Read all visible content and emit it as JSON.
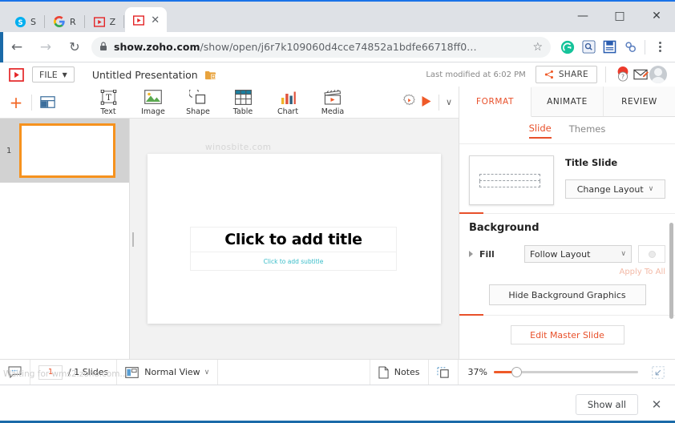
{
  "browser": {
    "tabs": [
      {
        "label": "S",
        "icon": "skype-icon",
        "active": false
      },
      {
        "label": "R",
        "icon": "google-icon",
        "active": false
      },
      {
        "label": "Z",
        "icon": "zoho-show-icon",
        "active": false
      },
      {
        "label": "",
        "icon": "zoho-show-icon",
        "active": true
      }
    ],
    "window_controls": {
      "minimize": "—",
      "maximize": "□",
      "close": "✕"
    },
    "nav": {
      "back": "←",
      "forward": "→",
      "reload": "↻"
    },
    "omnibox": {
      "lock": "lock-icon",
      "domain": "show.zoho.com",
      "path": "/show/open/j6r7k109060d4cce74852a1bdfe66718ff0…",
      "star": "☆"
    },
    "extensions": [
      "grammarly-icon",
      "magnifier-icon",
      "save-floppy-icon",
      "link-chain-icon"
    ],
    "menu": "kebab-menu-icon"
  },
  "app_header": {
    "logo": "zoho-show-logo",
    "file_menu": "FILE",
    "presentation_title": "Untitled Presentation",
    "folder_icon": "folder-add-icon",
    "last_modified": "Last modified at 6:02 PM",
    "share_label": "SHARE",
    "help_icon": "help-pin-icon",
    "feedback_icon": "feedback-edit-icon",
    "avatar": "user-avatar"
  },
  "insert_toolbar": {
    "add": "+",
    "layout_icon": "slide-layout-icon",
    "tools": [
      {
        "label": "Text",
        "icon": "text-box-icon"
      },
      {
        "label": "Image",
        "icon": "image-icon"
      },
      {
        "label": "Shape",
        "icon": "shape-icon"
      },
      {
        "label": "Table",
        "icon": "table-icon"
      },
      {
        "label": "Chart",
        "icon": "chart-icon"
      },
      {
        "label": "Media",
        "icon": "media-clapper-icon"
      }
    ],
    "settings_icon": "settings-gear-icon",
    "present_icon": "play-present-icon",
    "present_dropdown": "∨"
  },
  "right_panel": {
    "tabs": [
      {
        "label": "FORMAT",
        "active": true
      },
      {
        "label": "ANIMATE",
        "active": false
      },
      {
        "label": "REVIEW",
        "active": false
      }
    ],
    "subtabs": [
      {
        "label": "Slide",
        "active": true
      },
      {
        "label": "Themes",
        "active": false
      }
    ],
    "layout_name": "Title Slide",
    "change_layout": "Change Layout",
    "change_layout_caret": "∨",
    "background_title": "Background",
    "fill_label": "Fill",
    "fill_value": "Follow Layout",
    "fill_caret": "∨",
    "apply_to_all": "Apply To All",
    "hide_background": "Hide Background Graphics",
    "edit_master": "Edit Master Slide"
  },
  "workspace": {
    "slides": [
      {
        "number": "1"
      }
    ],
    "watermark": "winosbite.com",
    "title_placeholder": "Click to add title",
    "subtitle_placeholder": "Click to add subtitle"
  },
  "status_bar": {
    "comment_icon": "comment-icon",
    "current_slide": "1",
    "slide_count": "/ 1 Slides",
    "view_icon": "normal-view-icon",
    "view_label": "Normal View",
    "view_caret": "∨",
    "notes_icon": "notes-page-icon",
    "notes_label": "Notes",
    "grid_icon": "fit-slide-icon",
    "zoom_level": "37%",
    "fit_icon": "fit-screen-icon",
    "waiting_text": "Waiting for wms2.zoho.com…"
  },
  "download_bar": {
    "show_all": "Show all",
    "close": "✕"
  },
  "colors": {
    "accent": "#e8502a",
    "selection": "#f6921e",
    "browser_blue": "#1a73e8",
    "subtitle_teal": "#37bcc8"
  }
}
